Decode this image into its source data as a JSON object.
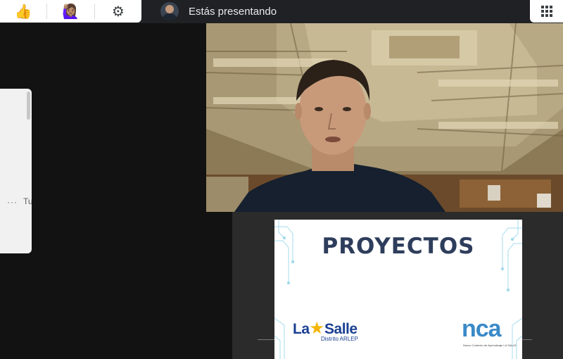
{
  "toolbar": {
    "reactions": [
      {
        "name": "thumbs-up",
        "glyph": "👍"
      },
      {
        "name": "raised-hand",
        "glyph": "🙋🏽‍♀️"
      }
    ],
    "settings_icon": "gear-icon"
  },
  "presenting": {
    "label": "Estás presentando"
  },
  "side_panel": {
    "dots": "···",
    "text": "Tu"
  },
  "slide": {
    "title": "PROYECTOS",
    "logo_left_name_1": "La",
    "logo_left_star": "★",
    "logo_left_name_2": "Salle",
    "logo_left_sub": "Distrito ARLEP",
    "logo_right_name": "nca",
    "logo_right_sub": "Nuevo Contexto de Aprendizaje LA SALLE"
  },
  "colors": {
    "slide_title": "#2e3d5c",
    "lasalle_blue": "#1a3f93",
    "lasalle_star": "#f4b400",
    "nca_blue": "#3a8ac8"
  }
}
